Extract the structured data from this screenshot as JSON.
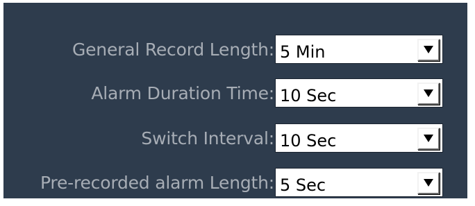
{
  "settings": {
    "rows": [
      {
        "label": "General Record Length:",
        "value": "5 Min"
      },
      {
        "label": "Alarm Duration Time:",
        "value": "10 Sec"
      },
      {
        "label": "Switch Interval:",
        "value": "10 Sec"
      },
      {
        "label": "Pre-recorded alarm Length:",
        "value": "5 Sec"
      }
    ]
  },
  "icons": {
    "dropdown": "chevron-down-icon"
  },
  "colors": {
    "panel_background": "#2e3c4d",
    "label_text": "#a7adb5",
    "field_background": "#ffffff",
    "field_text": "#000000"
  }
}
